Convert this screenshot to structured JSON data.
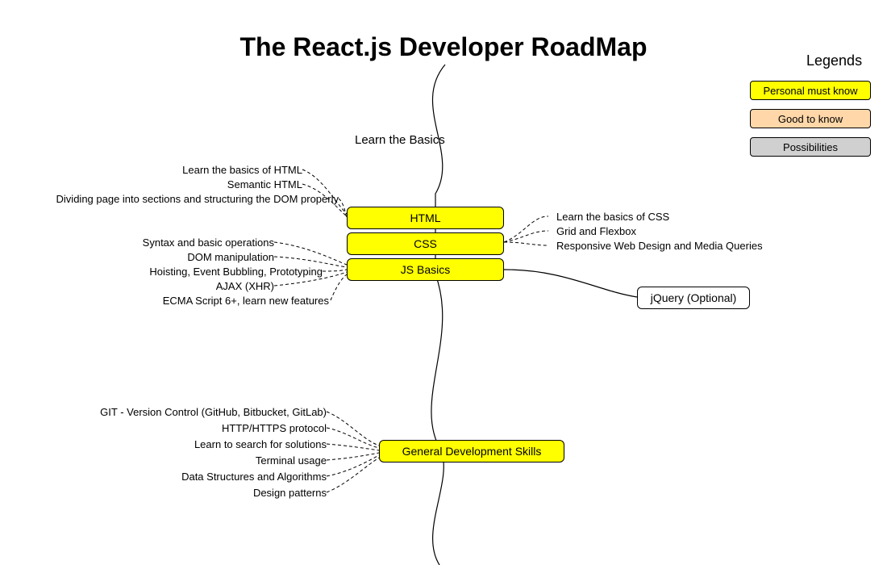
{
  "title": "The React.js Developer RoadMap",
  "section_label": "Learn the Basics",
  "legend": {
    "title": "Legends",
    "items": [
      {
        "label": "Personal must know",
        "cls": "legend-yellow"
      },
      {
        "label": "Good to know",
        "cls": "legend-peach"
      },
      {
        "label": "Possibilities",
        "cls": "legend-grey"
      }
    ]
  },
  "nodes": {
    "html": "HTML",
    "css": "CSS",
    "jsbasics": "JS Basics",
    "jquery": "jQuery (Optional)",
    "gds": "General Development Skills"
  },
  "leaves": {
    "html": [
      "Learn the basics of HTML",
      "Semantic HTML",
      "Dividing page into sections and structuring the DOM properly"
    ],
    "css": [
      "Learn the basics of CSS",
      "Grid and Flexbox",
      "Responsive Web Design and Media Queries"
    ],
    "js": [
      "Syntax and basic operations",
      "DOM manipulation",
      "Hoisting, Event Bubbling, Prototyping",
      "AJAX (XHR)",
      "ECMA Script 6+, learn new features"
    ],
    "gds": [
      "GIT - Version Control (GitHub, Bitbucket, GitLab)",
      "HTTP/HTTPS protocol",
      "Learn to search for solutions",
      "Terminal usage",
      "Data Structures and Algorithms",
      "Design patterns"
    ]
  },
  "colors": {
    "must_know": "#ffff00",
    "good_to_know": "#ffd7a8",
    "possibilities": "#d0d0d0"
  }
}
